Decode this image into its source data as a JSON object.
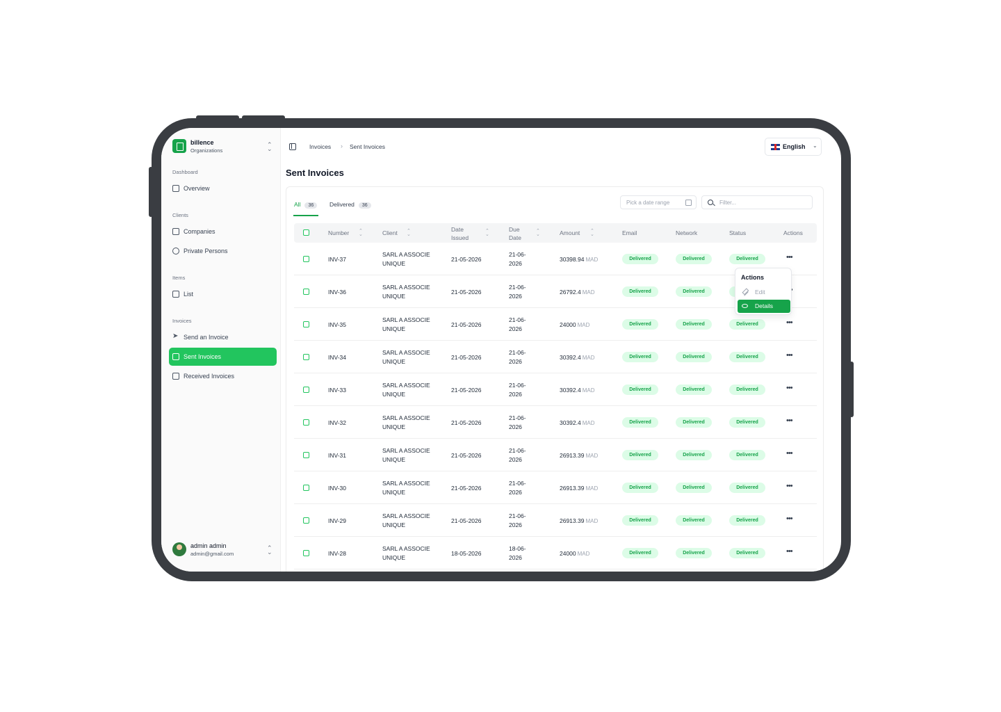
{
  "org": {
    "name": "billence",
    "subtitle": "Organizations"
  },
  "sidebar": {
    "sections": [
      {
        "title": "Dashboard",
        "items": [
          {
            "label": "Overview",
            "icon": "home-icon"
          }
        ]
      },
      {
        "title": "Clients",
        "items": [
          {
            "label": "Companies",
            "icon": "building-icon"
          },
          {
            "label": "Private Persons",
            "icon": "users-icon"
          }
        ]
      },
      {
        "title": "Items",
        "items": [
          {
            "label": "List",
            "icon": "package-icon"
          }
        ]
      },
      {
        "title": "Invoices",
        "items": [
          {
            "label": "Send an Invoice",
            "icon": "send-icon"
          },
          {
            "label": "Sent Invoices",
            "icon": "file-icon",
            "active": true
          },
          {
            "label": "Received Invoices",
            "icon": "file-import-icon"
          }
        ]
      }
    ]
  },
  "user": {
    "name": "admin admin",
    "email": "admin@gmail.com"
  },
  "breadcrumb": {
    "parent": "Invoices",
    "current": "Sent Invoices"
  },
  "language": {
    "label": "English",
    "flag": "uk-flag-icon"
  },
  "page": {
    "title": "Sent Invoices"
  },
  "tabs": {
    "all": {
      "label": "All",
      "count": "36"
    },
    "delivered": {
      "label": "Delivered",
      "count": "36"
    }
  },
  "filters": {
    "date_placeholder": "Pick a date range",
    "filter_placeholder": "Filter..."
  },
  "table": {
    "headers": {
      "number": "Number",
      "client": "Client",
      "date_issued_1": "Date",
      "date_issued_2": "Issued",
      "due_date_1": "Due",
      "due_date_2": "Date",
      "amount": "Amount",
      "email": "Email",
      "network": "Network",
      "status": "Status",
      "actions": "Actions"
    },
    "currency": "MAD",
    "rows": [
      {
        "number": "INV-37",
        "client_1": "SARL A ASSOCIE",
        "client_2": "UNIQUE",
        "issued": "21-05-2026",
        "due_1": "21-06-",
        "due_2": "2026",
        "amount": "30398.94",
        "email": "Delivered",
        "network": "Delivered",
        "status": "Delivered"
      },
      {
        "number": "INV-36",
        "client_1": "SARL A ASSOCIE",
        "client_2": "UNIQUE",
        "issued": "21-05-2026",
        "due_1": "21-06-",
        "due_2": "2026",
        "amount": "26792.4",
        "email": "Delivered",
        "network": "Delivered",
        "status": "De"
      },
      {
        "number": "INV-35",
        "client_1": "SARL A ASSOCIE",
        "client_2": "UNIQUE",
        "issued": "21-05-2026",
        "due_1": "21-06-",
        "due_2": "2026",
        "amount": "24000",
        "email": "Delivered",
        "network": "Delivered",
        "status": "Delivered"
      },
      {
        "number": "INV-34",
        "client_1": "SARL A ASSOCIE",
        "client_2": "UNIQUE",
        "issued": "21-05-2026",
        "due_1": "21-06-",
        "due_2": "2026",
        "amount": "30392.4",
        "email": "Delivered",
        "network": "Delivered",
        "status": "Delivered"
      },
      {
        "number": "INV-33",
        "client_1": "SARL A ASSOCIE",
        "client_2": "UNIQUE",
        "issued": "21-05-2026",
        "due_1": "21-06-",
        "due_2": "2026",
        "amount": "30392.4",
        "email": "Delivered",
        "network": "Delivered",
        "status": "Delivered"
      },
      {
        "number": "INV-32",
        "client_1": "SARL A ASSOCIE",
        "client_2": "UNIQUE",
        "issued": "21-05-2026",
        "due_1": "21-06-",
        "due_2": "2026",
        "amount": "30392.4",
        "email": "Delivered",
        "network": "Delivered",
        "status": "Delivered"
      },
      {
        "number": "INV-31",
        "client_1": "SARL A ASSOCIE",
        "client_2": "UNIQUE",
        "issued": "21-05-2026",
        "due_1": "21-06-",
        "due_2": "2026",
        "amount": "26913.39",
        "email": "Delivered",
        "network": "Delivered",
        "status": "Delivered"
      },
      {
        "number": "INV-30",
        "client_1": "SARL A ASSOCIE",
        "client_2": "UNIQUE",
        "issued": "21-05-2026",
        "due_1": "21-06-",
        "due_2": "2026",
        "amount": "26913.39",
        "email": "Delivered",
        "network": "Delivered",
        "status": "Delivered"
      },
      {
        "number": "INV-29",
        "client_1": "SARL A ASSOCIE",
        "client_2": "UNIQUE",
        "issued": "21-05-2026",
        "due_1": "21-06-",
        "due_2": "2026",
        "amount": "26913.39",
        "email": "Delivered",
        "network": "Delivered",
        "status": "Delivered"
      },
      {
        "number": "INV-28",
        "client_1": "SARL A ASSOCIE",
        "client_2": "UNIQUE",
        "issued": "18-05-2026",
        "due_1": "18-06-",
        "due_2": "2026",
        "amount": "24000",
        "email": "Delivered",
        "network": "Delivered",
        "status": "Delivered"
      }
    ]
  },
  "actions_menu": {
    "title": "Actions",
    "edit": "Edit",
    "details": "Details"
  },
  "colors": {
    "accent": "#16a34a",
    "active_nav": "#22c55e",
    "badge_bg": "#dcfce7",
    "frame": "#3a3d42"
  }
}
